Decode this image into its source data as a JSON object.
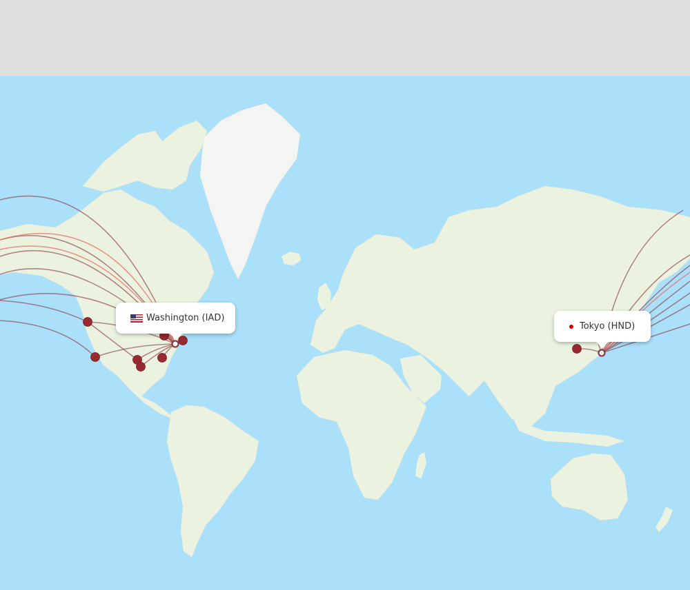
{
  "route": {
    "origin": {
      "label": "Washington (IAD)",
      "country_flag": "us-flag-icon"
    },
    "destination": {
      "label": "Tokyo (HND)",
      "marker": "red-dot-icon"
    }
  },
  "colors": {
    "ocean": "#abe0fa",
    "land": "#ebf3e0",
    "greenland": "#f2f5f1",
    "route_line": "#8b3a42",
    "route_highlight": "#e8746a",
    "airport_marker": "#962a30",
    "destination_dot": "#cc0000"
  }
}
